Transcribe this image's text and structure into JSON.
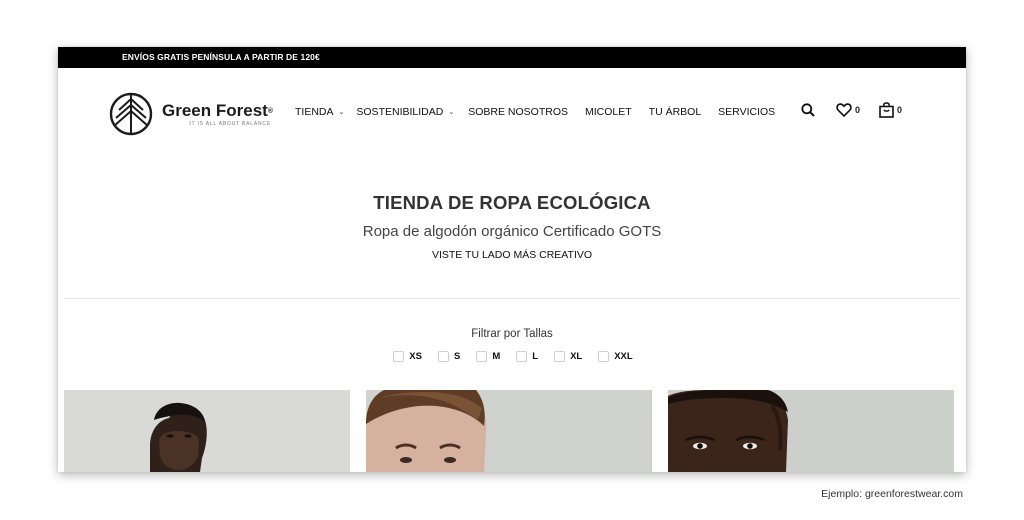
{
  "top_bar": {
    "text": "ENVÍOS GRATIS PENÍNSULA A PARTIR DE 120€"
  },
  "logo": {
    "name": "Green Forest",
    "registered": "®",
    "tagline": "IT IS ALL ABOUT BALANCE"
  },
  "nav": [
    {
      "label": "TIENDA",
      "has_dropdown": true
    },
    {
      "label": "SOSTENIBILIDAD",
      "has_dropdown": true
    },
    {
      "label": "SOBRE NOSOTROS",
      "has_dropdown": false
    },
    {
      "label": "MICOLET",
      "has_dropdown": false
    },
    {
      "label": "TU ÁRBOL",
      "has_dropdown": false
    },
    {
      "label": "SERVICIOS",
      "has_dropdown": false
    }
  ],
  "header_icons": {
    "search": "search-icon",
    "wishlist": {
      "icon": "heart-icon",
      "count": "0"
    },
    "cart": {
      "icon": "shopping-bag-icon",
      "count": "0"
    }
  },
  "hero": {
    "title": "TIENDA DE ROPA ECOLÓGICA",
    "subtitle": "Ropa de algodón orgánico Certificado GOTS",
    "tagline": "VISTE TU LADO MÁS CREATIVO"
  },
  "filter": {
    "label": "Filtrar por Tallas",
    "sizes": [
      "XS",
      "S",
      "M",
      "L",
      "XL",
      "XXL"
    ]
  },
  "products": [
    {
      "image": "product-photo-model-1"
    },
    {
      "image": "product-photo-model-2"
    },
    {
      "image": "product-photo-model-3"
    }
  ],
  "credit": "Ejemplo: greenforestwear.com",
  "colors": {
    "top_bar": "#000000",
    "background": "#ffffff",
    "text": "#222222",
    "photo_bg": "#d6d7d5"
  }
}
